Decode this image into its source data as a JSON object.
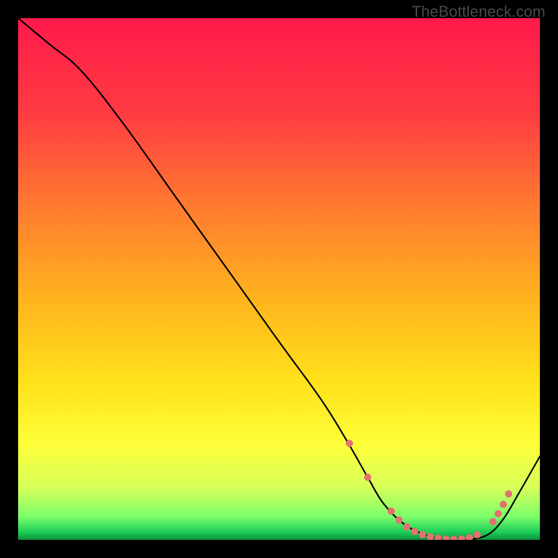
{
  "watermark": "TheBottleneck.com",
  "gradient": {
    "stops": [
      {
        "offset": 0.0,
        "color": "#ff1a4b"
      },
      {
        "offset": 0.18,
        "color": "#ff3b42"
      },
      {
        "offset": 0.36,
        "color": "#ff7a30"
      },
      {
        "offset": 0.54,
        "color": "#ffb41e"
      },
      {
        "offset": 0.7,
        "color": "#ffe21a"
      },
      {
        "offset": 0.82,
        "color": "#fdff3a"
      },
      {
        "offset": 0.9,
        "color": "#d7ff5a"
      },
      {
        "offset": 0.955,
        "color": "#7dff6a"
      },
      {
        "offset": 0.985,
        "color": "#1dce58"
      },
      {
        "offset": 1.0,
        "color": "#0e8f3a"
      }
    ]
  },
  "chart_data": {
    "type": "line",
    "title": "",
    "xlabel": "",
    "ylabel": "",
    "xlim": [
      0,
      100
    ],
    "ylim": [
      0,
      100
    ],
    "series": [
      {
        "name": "bottleneck-curve",
        "x": [
          0,
          6,
          12,
          20,
          30,
          40,
          50,
          58,
          63,
          67,
          70,
          74,
          78,
          82,
          86,
          90,
          93,
          96,
          100
        ],
        "y": [
          100,
          95,
          90,
          80,
          66,
          52,
          38,
          27,
          19,
          12,
          7,
          3,
          1,
          0,
          0,
          1,
          4,
          9,
          16
        ]
      }
    ],
    "markers": {
      "name": "recommended-range",
      "color": "#e4716f",
      "r": 5.2,
      "points": [
        {
          "x": 63.5,
          "y": 18.5
        },
        {
          "x": 67.0,
          "y": 12.0
        },
        {
          "x": 71.5,
          "y": 5.5
        },
        {
          "x": 73.0,
          "y": 3.8
        },
        {
          "x": 74.5,
          "y": 2.5
        },
        {
          "x": 76.0,
          "y": 1.6
        },
        {
          "x": 77.5,
          "y": 1.0
        },
        {
          "x": 79.0,
          "y": 0.6
        },
        {
          "x": 80.5,
          "y": 0.3
        },
        {
          "x": 82.0,
          "y": 0.15
        },
        {
          "x": 83.5,
          "y": 0.1
        },
        {
          "x": 85.0,
          "y": 0.15
        },
        {
          "x": 86.5,
          "y": 0.4
        },
        {
          "x": 88.0,
          "y": 1.0
        },
        {
          "x": 91.0,
          "y": 3.5
        },
        {
          "x": 92.0,
          "y": 5.0
        },
        {
          "x": 93.0,
          "y": 6.8
        },
        {
          "x": 94.0,
          "y": 8.8
        }
      ]
    }
  }
}
